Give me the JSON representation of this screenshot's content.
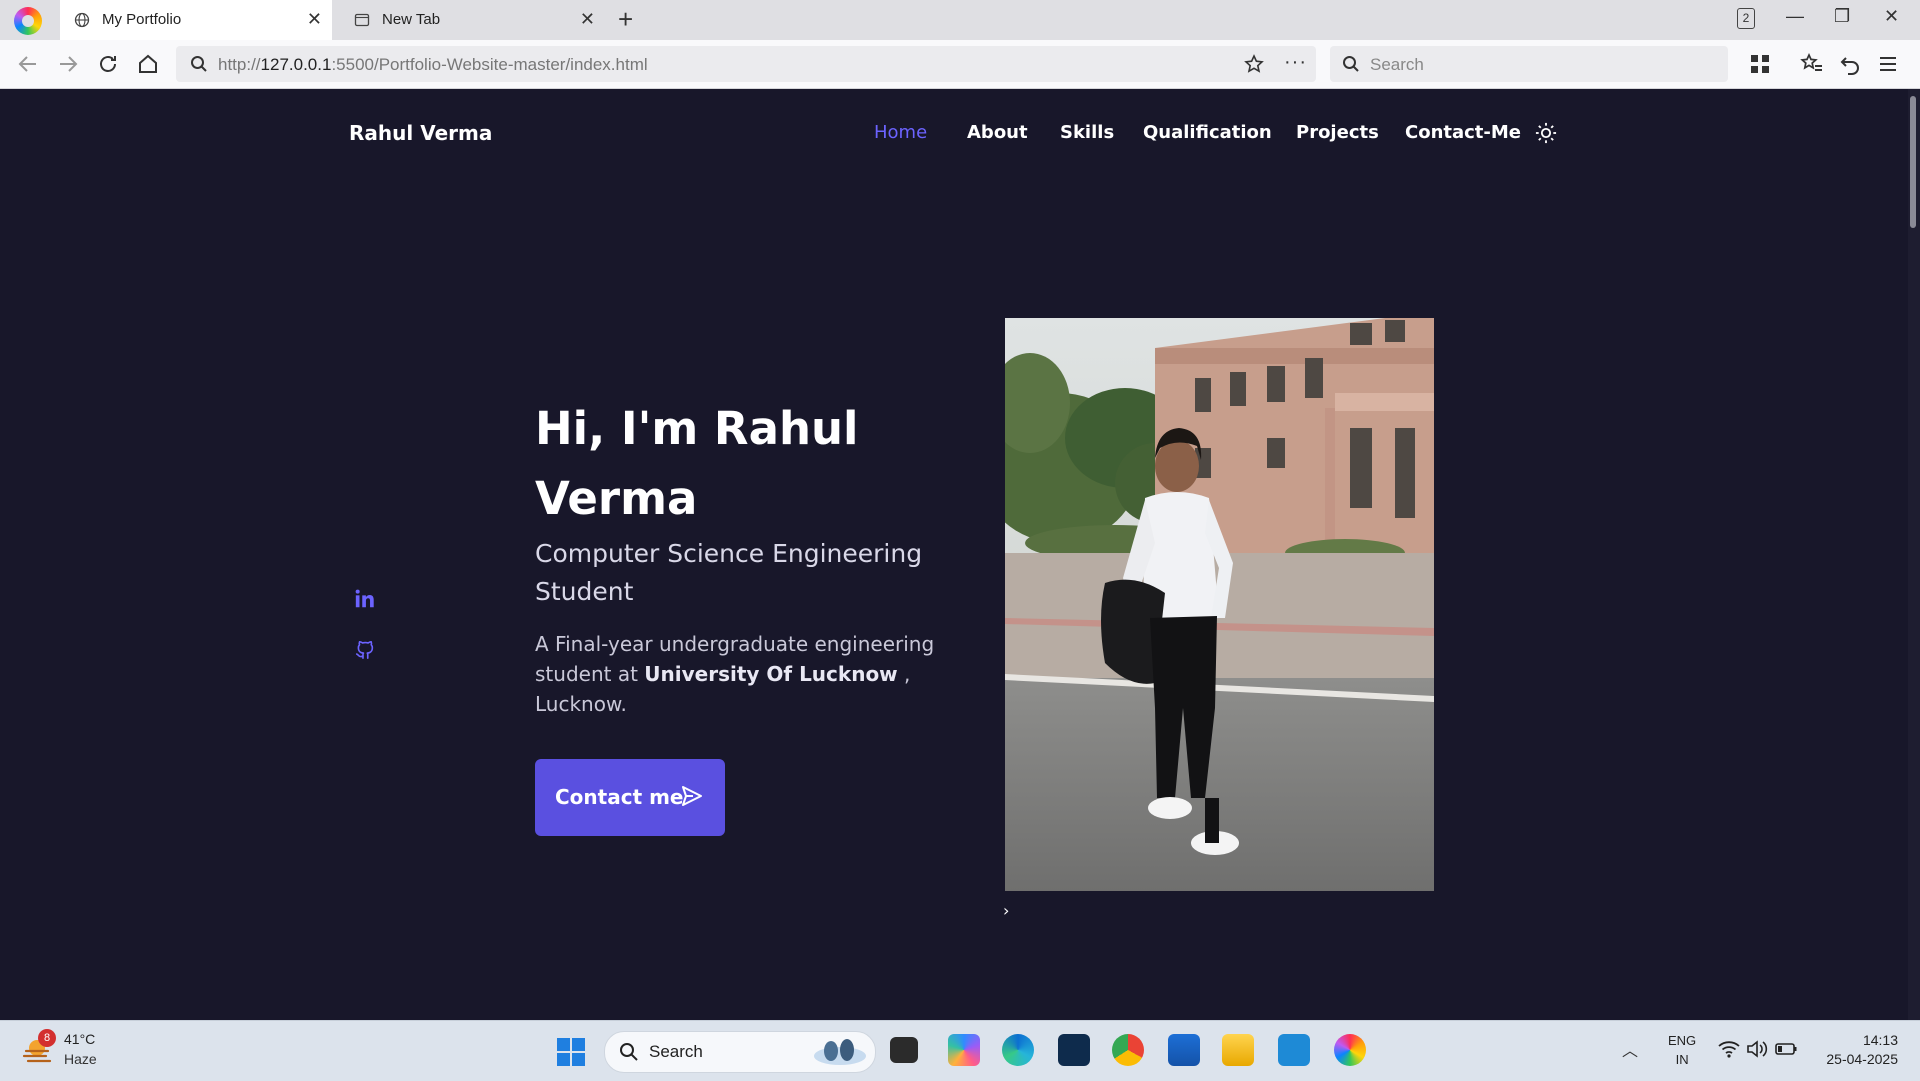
{
  "browser": {
    "tabs": [
      {
        "label": "My Portfolio",
        "active": true
      },
      {
        "label": "New Tab",
        "active": false
      }
    ],
    "tab_count": "2",
    "url": {
      "prefix": "http://",
      "host": "127.0.0.1",
      "rest": ":5500/Portfolio-Website-master/index.html"
    },
    "search_placeholder": "Search"
  },
  "site": {
    "brand": "Rahul Verma",
    "nav": [
      "Home",
      "About",
      "Skills",
      "Qualification",
      "Projects",
      "Contact-Me"
    ],
    "active_nav": "Home",
    "hero": {
      "title": "Hi, I'm Rahul Verma",
      "subtitle": "Computer Science Engineering Student",
      "desc_prefix": "A Final-year undergraduate engineering student at ",
      "desc_bold": "University Of Lucknow",
      "desc_suffix": " , Lucknow.",
      "cta": "Contact me",
      "carousel_next": "›"
    },
    "social": [
      "linkedin-icon",
      "github-icon"
    ],
    "accent": "#6c63ff",
    "background": "#18172a"
  },
  "taskbar": {
    "weather": {
      "temp": "41°C",
      "condition": "Haze",
      "badge": "8"
    },
    "search_label": "Search",
    "lang": {
      "line1": "ENG",
      "line2": "IN"
    },
    "clock": {
      "time": "14:13",
      "date": "25-04-2025"
    }
  }
}
